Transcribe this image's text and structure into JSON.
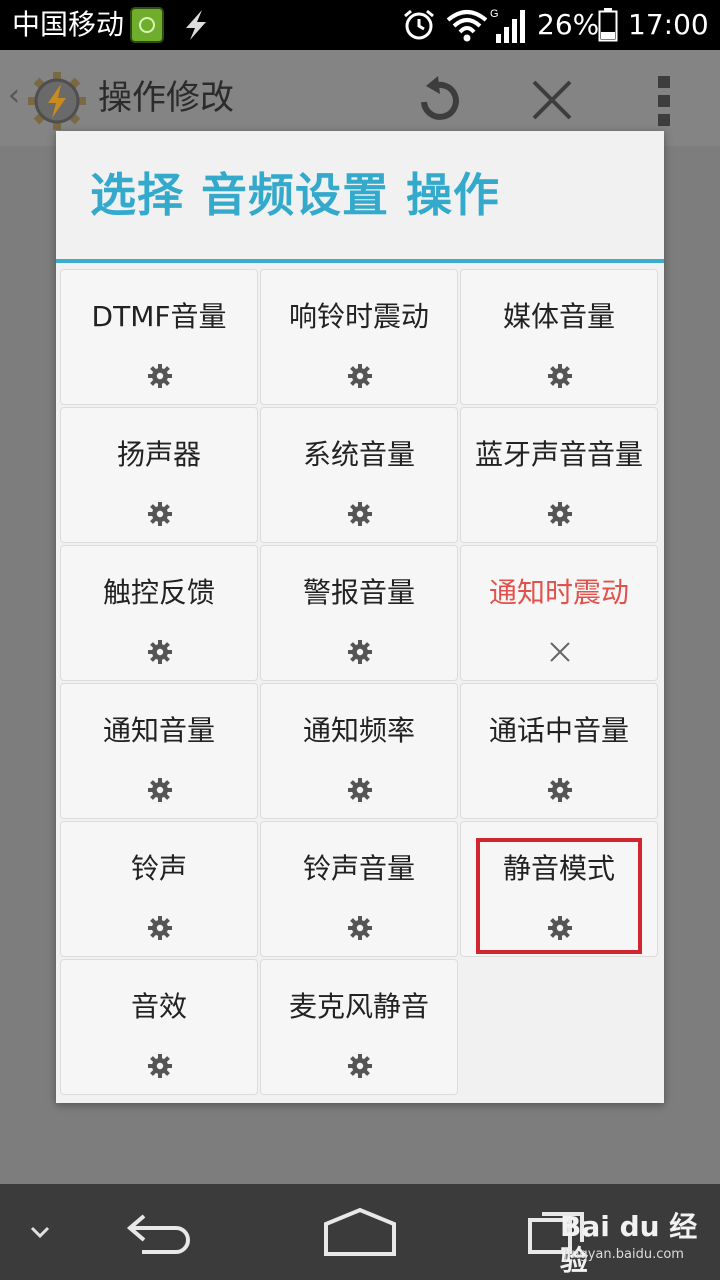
{
  "status_bar": {
    "carrier": "中国移动",
    "battery_percent": "26%",
    "time": "17:00",
    "battery_level": 0.26
  },
  "action_bar": {
    "title": "操作修改",
    "icons": [
      "back-chevron-icon",
      "tasker-logo-icon",
      "refresh-icon",
      "close-icon",
      "overflow-menu-icon"
    ]
  },
  "dialog": {
    "title": "选择 音频设置 操作",
    "accent_color": "#3aaccd",
    "items": [
      {
        "label": "DTMF音量",
        "icon": "gear-icon"
      },
      {
        "label": "响铃时震动",
        "icon": "gear-icon"
      },
      {
        "label": "媒体音量",
        "icon": "gear-icon"
      },
      {
        "label": "扬声器",
        "icon": "gear-icon"
      },
      {
        "label": "系统音量",
        "icon": "gear-icon"
      },
      {
        "label": "蓝牙声音音量",
        "icon": "gear-icon"
      },
      {
        "label": "触控反馈",
        "icon": "gear-icon"
      },
      {
        "label": "警报音量",
        "icon": "gear-icon"
      },
      {
        "label": "通知时震动",
        "icon": "close-icon",
        "status_color": "#e0524b"
      },
      {
        "label": "通知音量",
        "icon": "gear-icon"
      },
      {
        "label": "通知频率",
        "icon": "gear-icon"
      },
      {
        "label": "通话中音量",
        "icon": "gear-icon"
      },
      {
        "label": "铃声",
        "icon": "gear-icon"
      },
      {
        "label": "铃声音量",
        "icon": "gear-icon"
      },
      {
        "label": "静音模式",
        "icon": "gear-icon",
        "highlighted": true
      },
      {
        "label": "音效",
        "icon": "gear-icon"
      },
      {
        "label": "麦克风静音",
        "icon": "gear-icon"
      }
    ]
  },
  "watermark": {
    "main": "Bai du 经验",
    "sub": "jingyan.baidu.com"
  }
}
